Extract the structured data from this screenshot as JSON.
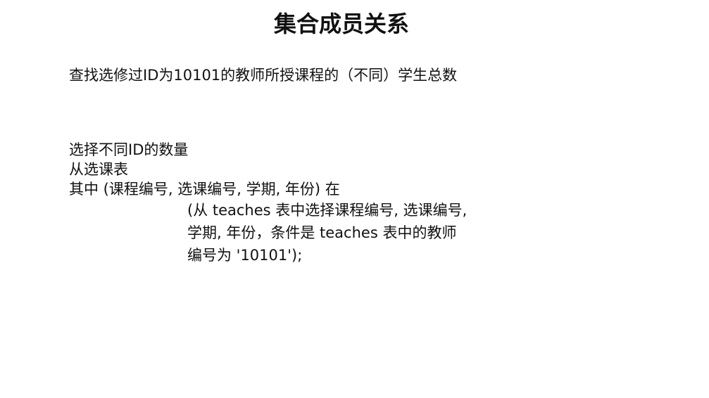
{
  "slide": {
    "title": "集合成员关系",
    "question": "查找选修过ID为10101的教师所授课程的（不同）学生总数",
    "query_lines": [
      "选择不同ID的数量",
      "从选课表",
      "其中 (课程编号, 选课编号, 学期, 年份) 在"
    ],
    "subquery": "(从 teaches 表中选择课程编号, 选课编号, 学期, 年份，条件是 teaches 表中的教师编号为 '10101');"
  }
}
